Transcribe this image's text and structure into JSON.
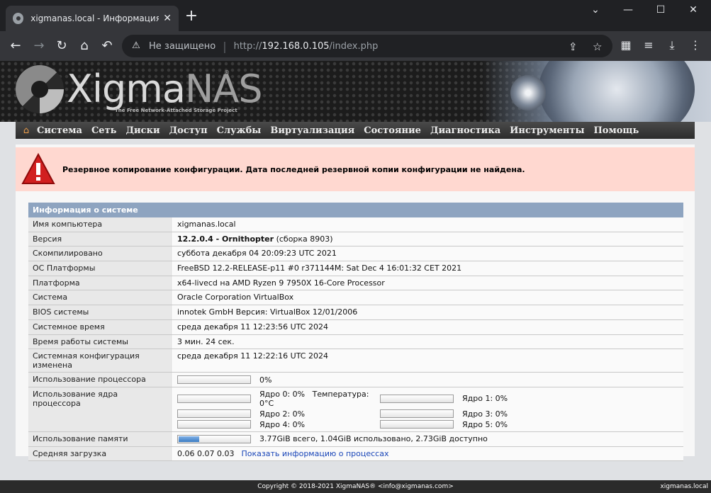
{
  "browser": {
    "tab_title": "xigmanas.local - Информация о сис",
    "close": "✕",
    "new_tab": "+",
    "minimize": "⌄",
    "window_min": "—",
    "window_max": "☐",
    "window_close": "✕",
    "security_text": "Не защищено",
    "url_scheme": "http://",
    "url_host": "192.168.0.105",
    "url_path": "/index.php"
  },
  "header": {
    "logo_xigma": "Xigma",
    "logo_nas": "NAS",
    "trademark": "®",
    "tagline": "The Free Network-Attached Storage Project"
  },
  "menu": [
    "Система",
    "Сеть",
    "Диски",
    "Доступ",
    "Службы",
    "Виртуализация",
    "Состояние",
    "Диагностика",
    "Инструменты",
    "Помощь"
  ],
  "alert": {
    "message": "Резервное копирование конфигурации. Дата последней резервной копии конфигурации не найдена."
  },
  "sysinfo": {
    "title": "Информация о системе",
    "rows": {
      "hostname": {
        "label": "Имя компьютера",
        "value": "xigmanas.local"
      },
      "version": {
        "label": "Версия",
        "value_bold": "12.2.0.4 - Ornithopter",
        "value_rest": " (сборка 8903)"
      },
      "compiled": {
        "label": "Скомпилировано",
        "value": "суббота декабря 04 20:09:23 UTC 2021"
      },
      "os": {
        "label": "ОС Платформы",
        "value": "FreeBSD 12.2-RELEASE-p11 #0 r371144M: Sat Dec 4 16:01:32 CET 2021"
      },
      "platform": {
        "label": "Платформа",
        "value": "x64-livecd на AMD Ryzen 9 7950X 16-Core Processor"
      },
      "system": {
        "label": "Система",
        "value": "Oracle Corporation VirtualBox"
      },
      "bios": {
        "label": "BIOS системы",
        "value": "innotek GmbH Версия: VirtualBox 12/01/2006"
      },
      "time": {
        "label": "Системное время",
        "value": "среда декабря 11 12:23:56 UTC 2024"
      },
      "uptime": {
        "label": "Время работы системы",
        "value": "3 мин. 24 сек."
      },
      "config_changed": {
        "label": "Системная конфигурация изменена",
        "value": "среда декабря 11 12:22:16 UTC 2024"
      },
      "cpu": {
        "label": "Использование процессора",
        "value": "0%",
        "fraction": 0
      },
      "cores": {
        "label": "Использование ядра процессора",
        "temperature": "Температура: 0°C",
        "items": [
          {
            "label": "Ядро 0: 0%",
            "fraction": 0
          },
          {
            "label": "Ядро 1: 0%",
            "fraction": 0
          },
          {
            "label": "Ядро 2: 0%",
            "fraction": 0
          },
          {
            "label": "Ядро 3: 0%",
            "fraction": 0
          },
          {
            "label": "Ядро 4: 0%",
            "fraction": 0
          },
          {
            "label": "Ядро 5: 0%",
            "fraction": 0
          }
        ]
      },
      "memory": {
        "label": "Использование памяти",
        "value": "3.77GiB всего, 1.04GiB использовано, 2.73GiB доступно",
        "fraction": 0.28
      },
      "load": {
        "label": "Средняя загрузка",
        "value": "0.06 0.07 0.03",
        "link": "Показать информацию о процессах"
      }
    }
  },
  "footer": {
    "copyright": "Copyright © 2018-2021 XigmaNAS® <info@xigmanas.com>",
    "host": "xigmanas.local"
  }
}
